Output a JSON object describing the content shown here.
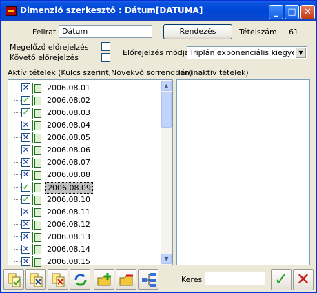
{
  "window": {
    "title": "Dimenzió szerkesztő : Dátum[DATUMA]",
    "minimize": "_",
    "maximize": "□",
    "close": "✕"
  },
  "form": {
    "felirat_label": "Felirat",
    "felirat_value": "Dátum",
    "rendezes_button": "Rendezés",
    "tetelszam_label": "Tételszám",
    "tetelszam_value": "61",
    "megelozo_label": "Megelőző előrejelzés",
    "koveto_label": "Követő előrejelzés",
    "elorejelzes_mod_label": "Előrejelzés módja",
    "elorejelzes_mod_value": "Triplán exponenciális kiegyenlítés"
  },
  "active_panel": {
    "header": "Aktív tételek (Kulcs szerint,Növekvő sorrendben)",
    "items": [
      {
        "label": "2006.08.01",
        "state": "x",
        "selected": false
      },
      {
        "label": "2006.08.02",
        "state": "v",
        "selected": false
      },
      {
        "label": "2006.08.03",
        "state": "v",
        "selected": false
      },
      {
        "label": "2006.08.04",
        "state": "x",
        "selected": false
      },
      {
        "label": "2006.08.05",
        "state": "x",
        "selected": false
      },
      {
        "label": "2006.08.06",
        "state": "x",
        "selected": false
      },
      {
        "label": "2006.08.07",
        "state": "x",
        "selected": false
      },
      {
        "label": "2006.08.08",
        "state": "x",
        "selected": false
      },
      {
        "label": "2006.08.09",
        "state": "v",
        "selected": true
      },
      {
        "label": "2006.08.10",
        "state": "v",
        "selected": false
      },
      {
        "label": "2006.08.11",
        "state": "x",
        "selected": false
      },
      {
        "label": "2006.08.12",
        "state": "x",
        "selected": false
      },
      {
        "label": "2006.08.13",
        "state": "x",
        "selected": false
      },
      {
        "label": "2006.08.14",
        "state": "x",
        "selected": false
      },
      {
        "label": "2006.08.15",
        "state": "x",
        "selected": false
      }
    ]
  },
  "inactive_panel": {
    "header": "Tár(inaktív tételek)"
  },
  "search": {
    "label": "Keres",
    "value": ""
  },
  "icons": {
    "check_mark": "✓",
    "x_mark": "✕"
  },
  "colors": {
    "titlebar": "#0046d5",
    "ok_green": "#21a121",
    "cancel_red": "#d01818"
  }
}
